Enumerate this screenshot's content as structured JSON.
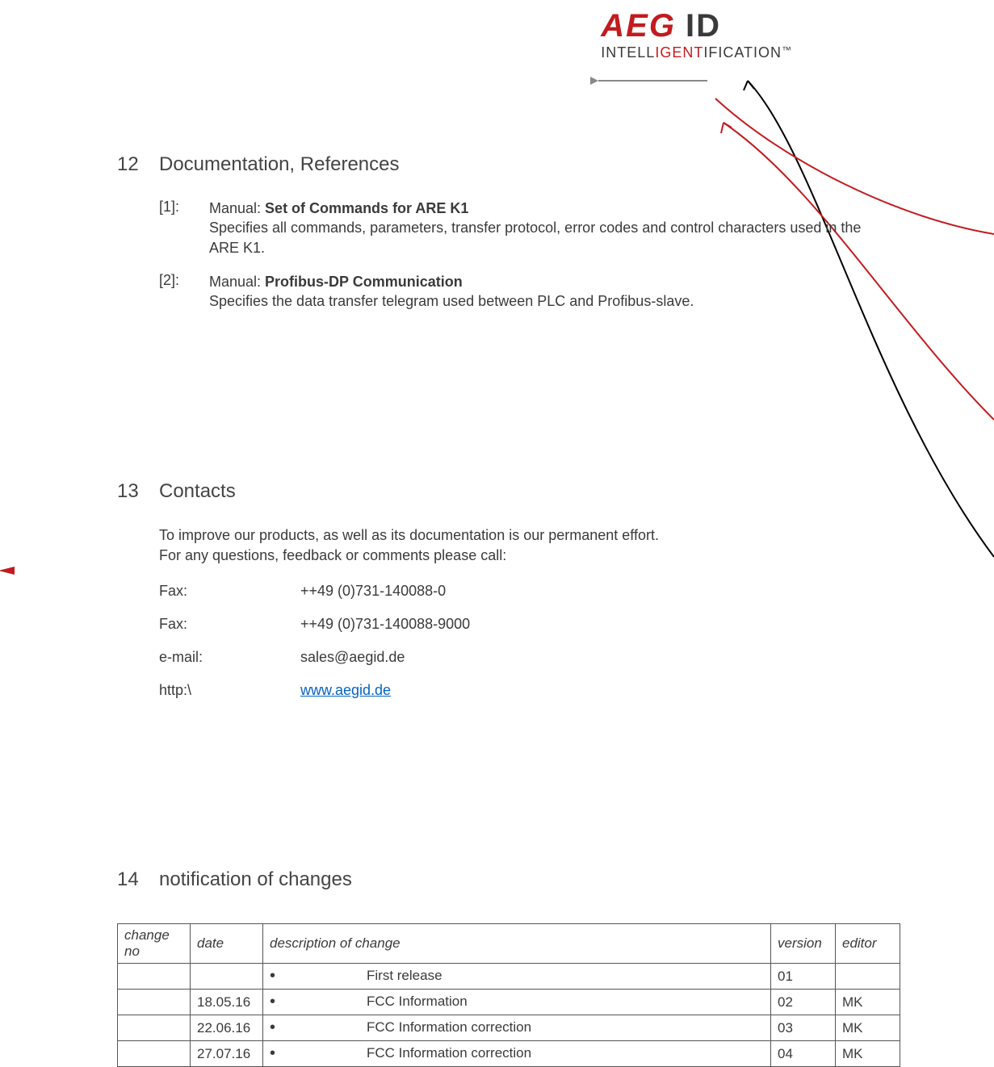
{
  "logo": {
    "aeg": "AEG",
    "id": "ID",
    "sub_pre": "INTELL",
    "sub_red": "IGENT",
    "sub_post": "IFICATION",
    "tm": "™"
  },
  "sections": {
    "s12": {
      "num": "12",
      "title": "Documentation, References"
    },
    "s13": {
      "num": "13",
      "title": "Contacts"
    },
    "s14": {
      "num": "14",
      "title": "notification of changes"
    }
  },
  "refs": [
    {
      "key": "[1]:",
      "pre": "Manual: ",
      "bold": "Set of Commands for ARE K1",
      "desc": "Specifies all commands, parameters, transfer protocol, error codes and control characters used in the ARE K1."
    },
    {
      "key": "[2]:",
      "pre": "Manual: ",
      "bold": "Profibus-DP Communication",
      "desc": "Specifies the data transfer telegram used between PLC and Profibus-slave."
    }
  ],
  "contacts": {
    "intro1": "To improve our products, as well as its documentation is our permanent effort.",
    "intro2": "For any questions, feedback or comments please call:",
    "rows": [
      {
        "label": "Fax:",
        "value": "++49 (0)731-140088-0",
        "link": false
      },
      {
        "label": "Fax:",
        "value": "++49 (0)731-140088-9000",
        "link": false
      },
      {
        "label": "e-mail:",
        "value": "sales@aegid.de",
        "link": false
      },
      {
        "label": "http:\\",
        "value": "www.aegid.de",
        "link": true
      }
    ]
  },
  "table": {
    "headers": {
      "no": "change no",
      "date": "date",
      "desc": "description of change",
      "ver": "version",
      "ed": "editor"
    },
    "rows": [
      {
        "no": "",
        "date": "",
        "desc": "First release",
        "ver": "01",
        "ed": ""
      },
      {
        "no": "",
        "date": "18.05.16",
        "desc": "FCC Information",
        "ver": "02",
        "ed": "MK"
      },
      {
        "no": "",
        "date": "22.06.16",
        "desc": "FCC Information correction",
        "ver": "03",
        "ed": "MK"
      },
      {
        "no": "",
        "date": "27.07.16",
        "desc": "FCC Information correction",
        "ver": "04",
        "ed": "MK"
      }
    ]
  }
}
